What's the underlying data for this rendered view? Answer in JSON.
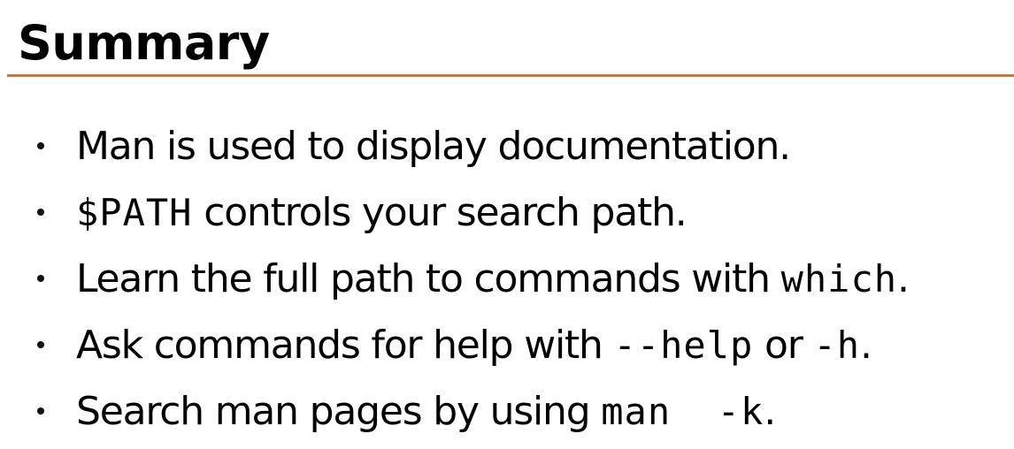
{
  "title": "Summary",
  "colors": {
    "rule": "#c97a3b",
    "text": "#000000",
    "background": "#ffffff"
  },
  "bullets": [
    {
      "text": "Man is used to display documentation."
    },
    {
      "code": "$PATH",
      "text": " controls your search path."
    },
    {
      "text": "Learn the full path to commands with ",
      "code": "which",
      "end": "."
    },
    {
      "text": "Ask commands for help with ",
      "code1": "--help",
      "mid": " or ",
      "code2": "-h",
      "end": "."
    },
    {
      "text": "Search man pages by using ",
      "code": "man  -k",
      "end": "."
    }
  ]
}
